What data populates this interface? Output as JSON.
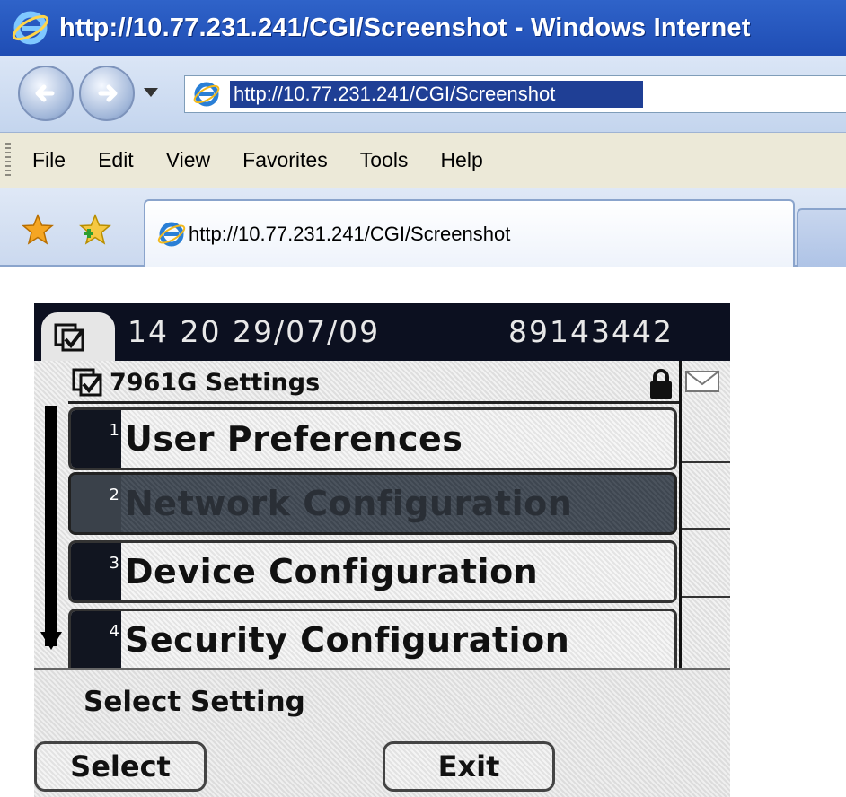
{
  "window": {
    "title": "http://10.77.231.241/CGI/Screenshot - Windows Internet"
  },
  "address_bar": {
    "url": "http://10.77.231.241/CGI/Screenshot"
  },
  "menu": {
    "items": [
      "File",
      "Edit",
      "View",
      "Favorites",
      "Tools",
      "Help"
    ]
  },
  "tab": {
    "label": "http://10.77.231.241/CGI/Screenshot"
  },
  "phone": {
    "header": {
      "time_date": "14 20 29/07/09",
      "number": "89143442"
    },
    "settings_title": "7961G Settings",
    "rows": [
      {
        "num": "1",
        "label": "User Preferences",
        "selected": false
      },
      {
        "num": "2",
        "label": "Network Configuration",
        "selected": true
      },
      {
        "num": "3",
        "label": "Device Configuration",
        "selected": false
      },
      {
        "num": "4",
        "label": "Security Configuration",
        "selected": false
      }
    ],
    "status_text": "Select Setting",
    "softkeys": {
      "select": "Select",
      "exit": "Exit"
    }
  },
  "colors": {
    "title_bar": "#2f63c9",
    "phone_header": "#0c1020",
    "selected_row": "#444c56"
  },
  "icons": [
    "ie-logo-icon",
    "back-icon",
    "forward-icon",
    "favorites-star-icon",
    "add-favorite-icon",
    "settings-checkbox-icon",
    "lock-icon",
    "envelope-icon",
    "scroll-down-icon"
  ]
}
